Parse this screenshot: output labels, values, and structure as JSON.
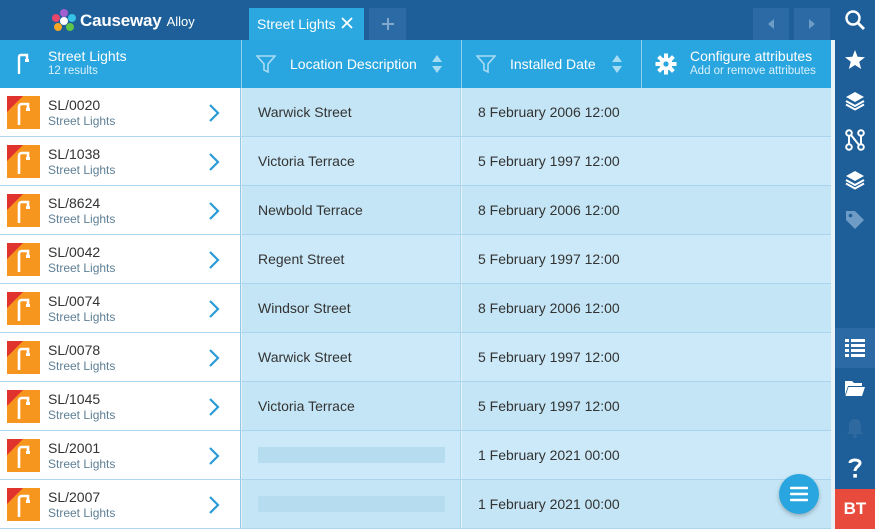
{
  "app": {
    "logo_text": "Causeway",
    "logo_sub": "Alloy"
  },
  "tabs": [
    {
      "label": "Street Lights",
      "active": true
    }
  ],
  "header": {
    "title": "Street Lights",
    "count": "12 results",
    "columns": [
      {
        "label": "Location Description"
      },
      {
        "label": "Installed Date"
      }
    ],
    "configure": {
      "title": "Configure attributes",
      "subtitle": "Add or remove attributes"
    }
  },
  "rows": [
    {
      "id": "SL/0020",
      "type": "Street Lights",
      "location": "Warwick Street",
      "installed": "8 February 2006 12:00"
    },
    {
      "id": "SL/1038",
      "type": "Street Lights",
      "location": "Victoria Terrace",
      "installed": "5 February 1997 12:00"
    },
    {
      "id": "SL/8624",
      "type": "Street Lights",
      "location": "Newbold Terrace",
      "installed": "8 February 2006 12:00"
    },
    {
      "id": "SL/0042",
      "type": "Street Lights",
      "location": "Regent Street",
      "installed": "5 February 1997 12:00"
    },
    {
      "id": "SL/0074",
      "type": "Street Lights",
      "location": "Windsor Street",
      "installed": "8 February 2006 12:00"
    },
    {
      "id": "SL/0078",
      "type": "Street Lights",
      "location": "Warwick Street",
      "installed": "5 February 1997 12:00"
    },
    {
      "id": "SL/1045",
      "type": "Street Lights",
      "location": "Victoria Terrace",
      "installed": "5 February 1997 12:00"
    },
    {
      "id": "SL/2001",
      "type": "Street Lights",
      "location": "",
      "installed": "1 February 2021 00:00"
    },
    {
      "id": "SL/2007",
      "type": "Street Lights",
      "location": "",
      "installed": "1 February 2021 00:00"
    }
  ],
  "sidebar": {
    "items": [
      {
        "icon": "search-icon"
      },
      {
        "icon": "star-icon"
      },
      {
        "icon": "layers-icon"
      },
      {
        "icon": "workflow-icon"
      },
      {
        "icon": "layers-alt-icon"
      },
      {
        "icon": "tag-icon"
      },
      {
        "icon": "table-icon",
        "active": true
      },
      {
        "icon": "folder-icon"
      },
      {
        "icon": "bell-icon"
      },
      {
        "icon": "help-icon"
      }
    ],
    "user_initials": "BT"
  },
  "colors": {
    "topbar": "#1e5f99",
    "accent": "#29a6df",
    "row_bg": "#c4e5f5",
    "thumb_orange": "#f7961e",
    "thumb_red": "#e0332d",
    "user_badge": "#e84b3c"
  }
}
